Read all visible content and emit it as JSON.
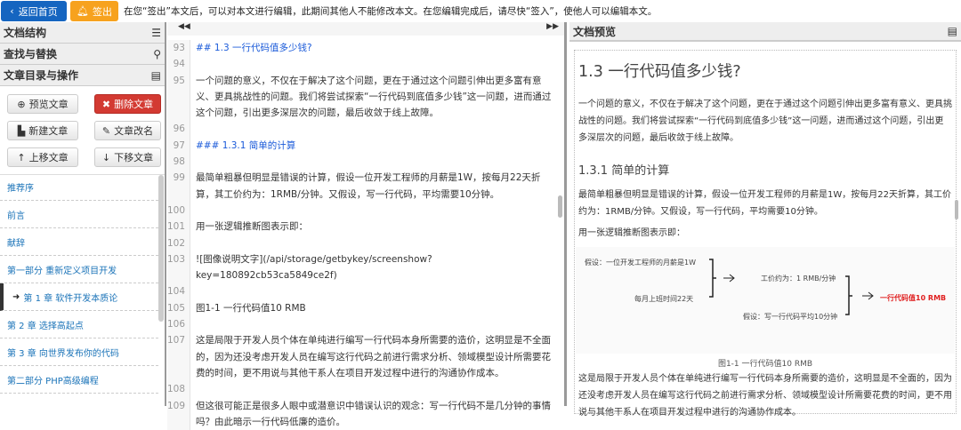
{
  "topbar": {
    "home_label": "返回首页",
    "signout_label": "签出",
    "notice": "在您“签出”本文后，可以对本文进行编辑，此期间其他人不能修改本文。在您编辑完成后，请尽快“签入”，使他人可以编辑本文。"
  },
  "left": {
    "panels": [
      "文档结构",
      "查找与替换",
      "文章目录与操作"
    ],
    "buttons": {
      "preview": "预览文章",
      "delete": "删除文章",
      "new": "新建文章",
      "rename": "文章改名",
      "up": "上移文章",
      "down": "下移文章"
    },
    "toc": [
      "推荐序",
      "前言",
      "献辞",
      "第一部分 重新定义项目开发",
      "第 1 章 软件开发本质论",
      "第 2 章 选择高起点",
      "第 3 章 向世界发布你的代码",
      "第二部分 PHP高级编程"
    ]
  },
  "editor": {
    "lines": [
      {
        "n": "93",
        "t": "## 1.3 一行代码值多少钱?",
        "h": true
      },
      {
        "n": "94",
        "t": ""
      },
      {
        "n": "95",
        "t": "一个问题的意义，不仅在于解决了这个问题，更在于通过这个问题引伸出更多富有意"
      },
      {
        "n": "",
        "t": "义、更具挑战性的问题。我们将尝试探索“一行代码到底值多少钱”这一问题，进而通过"
      },
      {
        "n": "",
        "t": "这个问题，引出更多深层次的问题，最后收敛于线上故障。"
      },
      {
        "n": "96",
        "t": ""
      },
      {
        "n": "97",
        "t": "### 1.3.1 简单的计算",
        "h": true
      },
      {
        "n": "98",
        "t": ""
      },
      {
        "n": "99",
        "t": "最简单粗暴但明显是错误的计算，假设一位开发工程师的月薪是1W，按每月22天折"
      },
      {
        "n": "",
        "t": "算，其工价约为：1RMB/分钟。又假设，写一行代码，平均需要10分钟。"
      },
      {
        "n": "100",
        "t": ""
      },
      {
        "n": "101",
        "t": "用一张逻辑推断图表示即："
      },
      {
        "n": "102",
        "t": ""
      },
      {
        "n": "103",
        "t": "![图像说明文字](/api/storage/getbykey/screenshow?key=180892cb53ca5849ce2f)"
      },
      {
        "n": "104",
        "t": ""
      },
      {
        "n": "105",
        "t": "图1-1 一行代码值10 RMB"
      },
      {
        "n": "106",
        "t": ""
      },
      {
        "n": "107",
        "t": "这是局限于开发人员个体在单纯进行编写一行代码本身所需要的造价，这明显是不全面"
      },
      {
        "n": "",
        "t": "的，因为还没考虑开发人员在编写这行代码之前进行需求分析、领域模型设计所需要花"
      },
      {
        "n": "",
        "t": "费的时间，更不用说与其他干系人在项目开发过程中进行的沟通协作成本。"
      },
      {
        "n": "108",
        "t": ""
      },
      {
        "n": "109",
        "t": "但这很可能正是很多人眼中或潜意识中错误认识的观念：写一行代码不是几分钟的事情"
      },
      {
        "n": "",
        "t": "吗？由此暗示一行代码低廉的造价。"
      }
    ]
  },
  "preview": {
    "title": "文档预览",
    "h1": "1.3 一行代码值多少钱?",
    "p1": "一个问题的意义，不仅在于解决了这个问题，更在于通过这个问题引伸出更多富有意义、更具挑战性的问题。我们将尝试探索“一行代码到底值多少钱”这一问题，进而通过这个问题，引出更多深层次的问题，最后收敛于线上故障。",
    "h3": "1.3.1 简单的计算",
    "p2": "最简单粗暴但明显是错误的计算，假设一位开发工程师的月薪是1W，按每月22天折算，其工价约为：1RMB/分钟。又假设，写一行代码，平均需要10分钟。",
    "p3": "用一张逻辑推断图表示即：",
    "figure": {
      "a": "假设：一位开发工程师的月薪是1W",
      "b": "每月上班时间22天",
      "c": "工价约为：1 RMB/分钟",
      "d": "假设：写一行代码平均10分钟",
      "e": "一行代码值10 RMB"
    },
    "caption": "图1-1 一行代码值10 RMB",
    "p4": "这是局限于开发人员个体在单纯进行编写一行代码本身所需要的造价，这明显是不全面的，因为还没考虑开发人员在编写这行代码之前进行需求分析、领域模型设计所需要花费的时间，更不用说与其他干系人在项目开发过程中进行的沟通协作成本。"
  },
  "colors": {
    "primary": "#1565c0",
    "warning": "#f7a21e",
    "danger": "#d33a32",
    "link": "#1a73b8"
  }
}
